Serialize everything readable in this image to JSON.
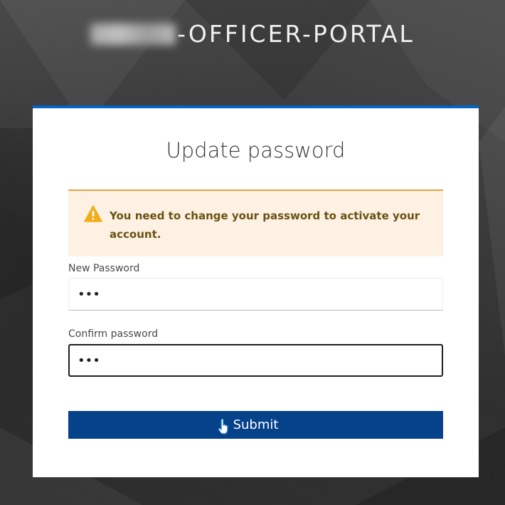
{
  "header": {
    "title_suffix": "-OFFICER-PORTAL"
  },
  "card": {
    "title": "Update password",
    "accent_color": "#0066cc"
  },
  "alert": {
    "icon": "warning-triangle-icon",
    "message": "You need to change your password to activate your account.",
    "background_color": "#fdf1e3",
    "border_color": "#e59f3a"
  },
  "form": {
    "new_password": {
      "label": "New Password",
      "value": "•••"
    },
    "confirm_password": {
      "label": "Confirm password",
      "value": "•••"
    },
    "submit_label": "Submit",
    "submit_color": "#06428a"
  }
}
